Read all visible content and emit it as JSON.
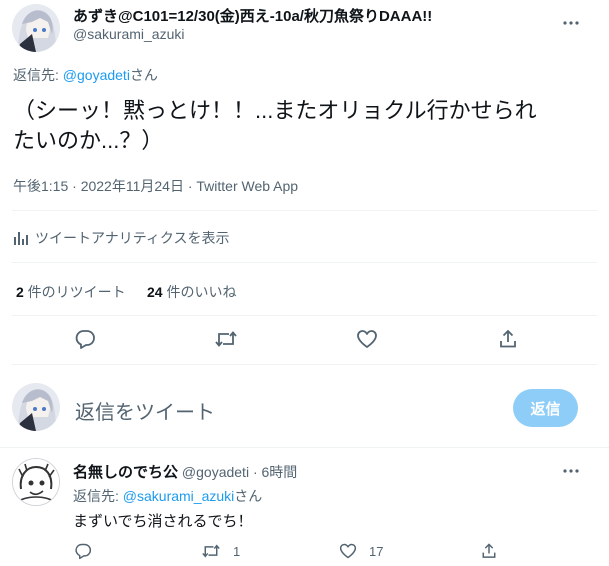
{
  "tweet": {
    "author_name": "あずき@C101=12/30(金)西え-10a/秋刀魚祭りDAAA!!",
    "author_handle": "@sakurami_azuki",
    "reply_prefix": "返信先: ",
    "reply_to": "@goyadeti",
    "reply_suffix": "さん",
    "text_line1": "（シーッ！黙っとけ！！...またオリョクル行かせられ",
    "text_line2": "たいのか...？）",
    "timestamp": "午後1:15 · 2022年11月24日 · Twitter Web App",
    "analytics": "ツイートアナリティクスを表示",
    "retweets_count": "2",
    "retweets_label": " 件のリツイート",
    "likes_count": "24",
    "likes_label": " 件のいいね"
  },
  "composer": {
    "placeholder": "返信をツイート",
    "button": "返信"
  },
  "reply": {
    "author_name": "名無しのでち公",
    "author_handle": "@goyadeti",
    "time": " · 6時間",
    "reply_prefix": "返信先: ",
    "reply_to": "@sakurami_azuki",
    "reply_suffix": "さん",
    "text": "まずいでち消されるでち！",
    "retweets": "1",
    "likes": "17"
  },
  "colors": {
    "accent": "#1d9bf0",
    "muted": "#536471",
    "button_disabled": "#8ecdf8"
  },
  "icons": [
    "more-icon",
    "analytics-icon",
    "reply-icon",
    "retweet-icon",
    "like-icon",
    "share-icon"
  ]
}
